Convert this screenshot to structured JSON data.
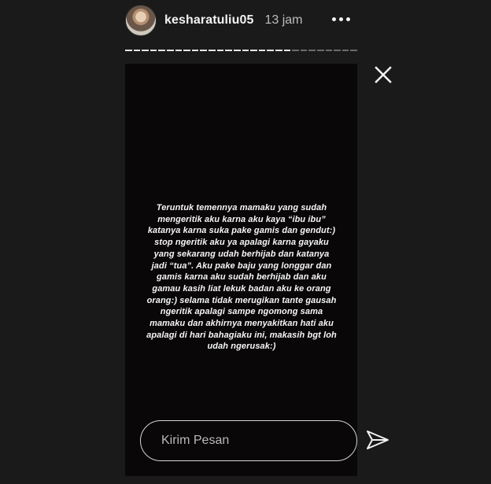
{
  "header": {
    "username": "kesharatuliu05",
    "time": "13 jam"
  },
  "progress": {
    "segments_total": 28,
    "segments_completed": 20
  },
  "story": {
    "text": "Teruntuk temennya mamaku yang sudah\nmengeritik aku karna aku kaya “ibu ibu”\nkatanya karna suka pake gamis dan gendut:)\nstop ngeritik aku ya apalagi karna gayaku\nyang sekarang udah berhijab dan katanya\njadi “tua”. Aku pake baju yang longgar dan\ngamis karna aku sudah berhijab dan aku\ngamau kasih liat lekuk badan aku ke orang\norang:) selama tidak merugikan tante gausah\nngeritik apalagi sampe ngomong sama\nmamaku dan akhirnya menyakitkan hati aku\napalagi di hari bahagiaku ini, makasih bgt loh\nudah ngerusak:)"
  },
  "reply": {
    "placeholder": "Kirim Pesan"
  },
  "icons": {
    "more": "more-options-icon",
    "close": "close-icon",
    "send": "send-icon"
  },
  "colors": {
    "background": "#1a1a1a",
    "story_background": "#090707",
    "text": "#f7f7f7"
  }
}
